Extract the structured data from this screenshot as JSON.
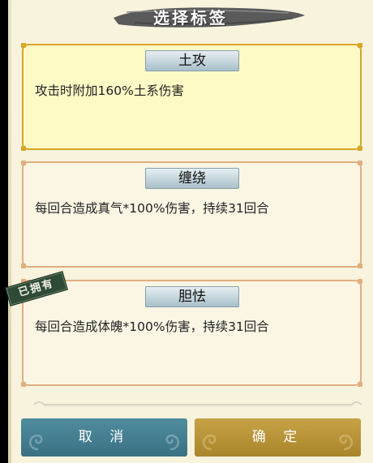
{
  "header": {
    "title": "选择标签"
  },
  "options": [
    {
      "tag": "土攻",
      "desc": "攻击时附加160%土系伤害",
      "selected": true
    },
    {
      "tag": "缠绕",
      "desc": "每回合造成真气*100%伤害，持续31回合",
      "selected": false
    },
    {
      "tag": "胆怯",
      "desc": "每回合造成体魄*100%伤害，持续31回合",
      "selected": false
    }
  ],
  "owned_stamp": "已拥有",
  "footer": {
    "cancel_label": "取 消",
    "confirm_label": "确 定"
  },
  "colors": {
    "panel": "#f7f3dd",
    "selected_card": "#fdfac6",
    "cancel_button": "#3f7a8c",
    "confirm_button": "#b6902f"
  }
}
